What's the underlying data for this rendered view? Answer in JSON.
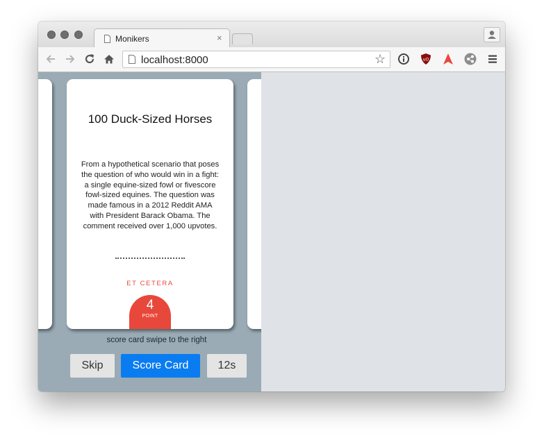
{
  "browser": {
    "tab_title": "Monikers",
    "tab_close": "×",
    "url": "localhost:8000",
    "star": "☆"
  },
  "card": {
    "title": "100 Duck-Sized Horses",
    "description": "From a hypothetical scenario that poses the question of who would win in a fight: a single equine-sized fowl or fivescore fowl-sized equines. The question was made famous in a 2012 Reddit AMA with President Barack Obama. The comment received over 1,000 upvotes.",
    "category": "ET CETERA",
    "points": "4",
    "points_label": "POINT"
  },
  "game": {
    "hint": "score card swipe to the right",
    "skip_label": "Skip",
    "score_label": "Score Card",
    "timer_label": "12s"
  },
  "colors": {
    "accent_red": "#e8483b",
    "primary_blue": "#0a7cf1",
    "phone_bg": "#9aabb5",
    "page_bg": "#dfe3e7"
  },
  "icons": [
    "back-icon",
    "forward-icon",
    "reload-icon",
    "home-icon",
    "page-icon",
    "star-icon",
    "info-icon",
    "ublock-icon",
    "triangle-extension-icon",
    "share-extension-icon",
    "menu-icon",
    "profile-icon"
  ]
}
